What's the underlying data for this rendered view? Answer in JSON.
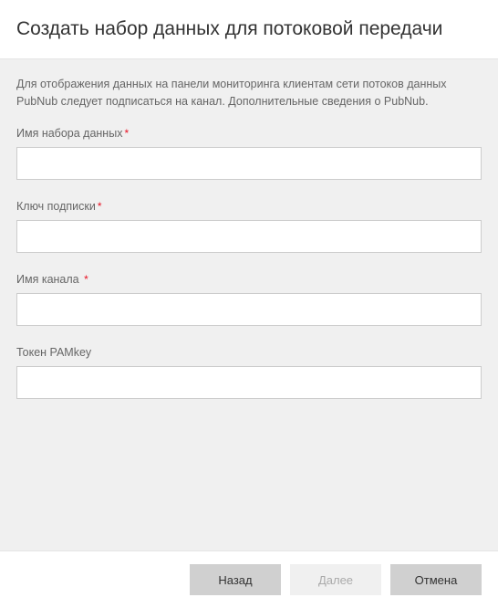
{
  "header": {
    "title": "Создать набор данных для потоковой передачи"
  },
  "body": {
    "description": "Для отображения данных на панели мониторинга клиентам сети потоков данных PubNub следует подписаться на канал. Дополнительные сведения о PubNub."
  },
  "form": {
    "fields": [
      {
        "label": "Имя набора данных",
        "required": true,
        "value": ""
      },
      {
        "label": "Ключ подписки",
        "required": true,
        "value": ""
      },
      {
        "label": "Имя канала",
        "required": true,
        "value": ""
      },
      {
        "label": "Токен PAMkey",
        "required": false,
        "value": ""
      }
    ],
    "required_marker": "*"
  },
  "footer": {
    "back": "Назад",
    "next": "Далее",
    "cancel": "Отмена"
  }
}
